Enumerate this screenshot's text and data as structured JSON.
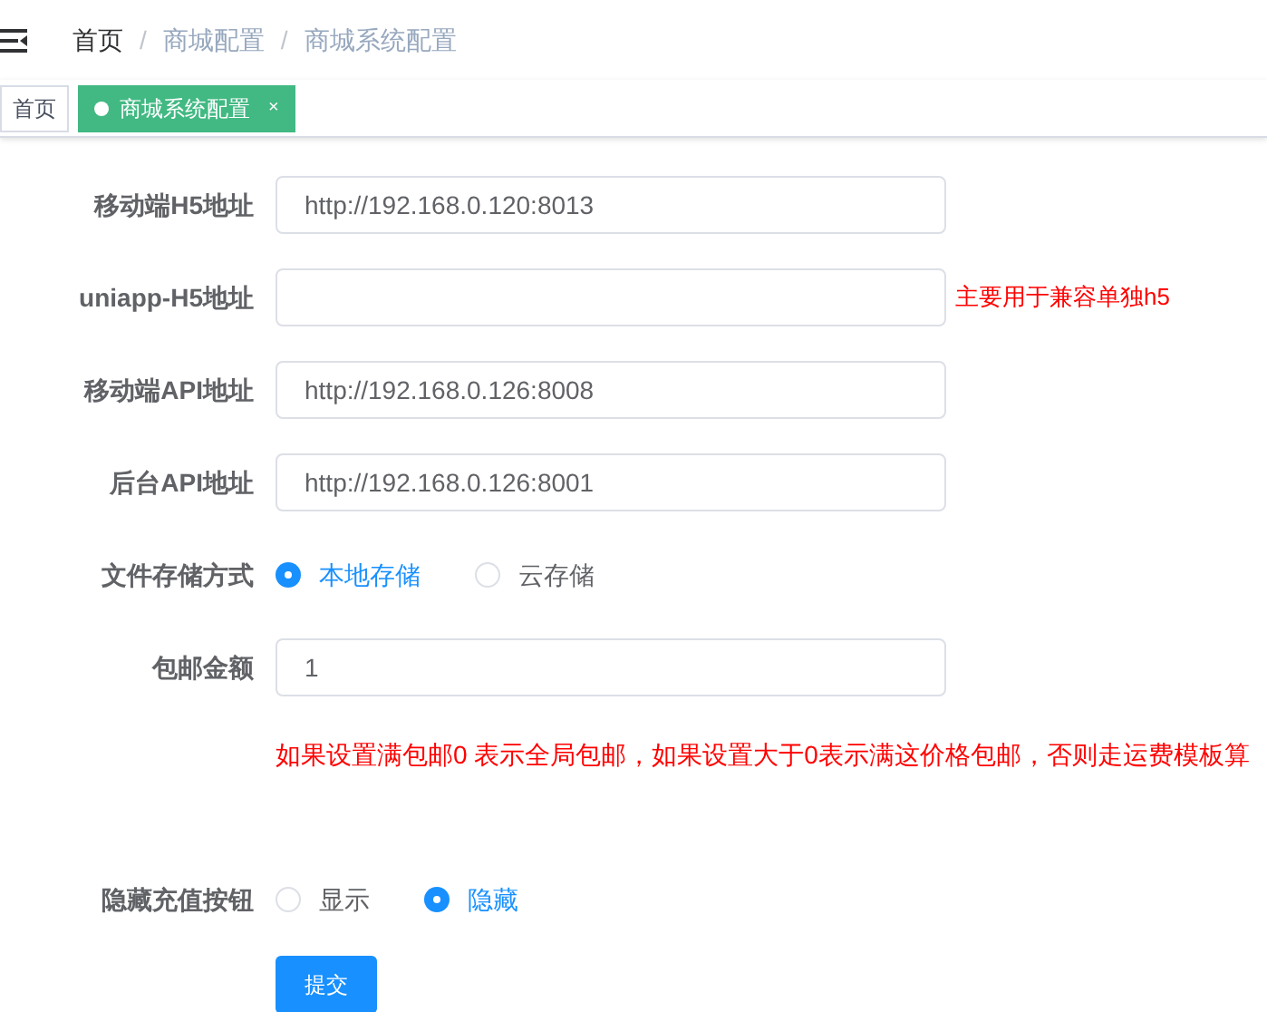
{
  "breadcrumb": [
    {
      "label": "首页",
      "current": true
    },
    {
      "separator": "/",
      "label": "商城配置",
      "current": false
    },
    {
      "separator": "/",
      "label": "商城系统配置",
      "current": false
    }
  ],
  "tabs": [
    {
      "label": "首页",
      "selected": false
    },
    {
      "label": "商城系统配置",
      "selected": true,
      "close": "×"
    }
  ],
  "form": {
    "fields": [
      {
        "kind": "input",
        "label": "移动端H5地址",
        "value": "http://192.168.0.120:8013"
      },
      {
        "kind": "input",
        "label": "uniapp-H5地址",
        "hint": "主要用于兼容单独h5"
      },
      {
        "kind": "input",
        "label": "移动端API地址",
        "value": "http://192.168.0.126:8008"
      },
      {
        "kind": "input",
        "label": "后台API地址",
        "value": "http://192.168.0.126:8001"
      },
      {
        "kind": "radio",
        "label": "文件存储方式",
        "options": [
          {
            "label": "本地存储",
            "selected": true
          },
          {
            "label": "云存储",
            "selected": false
          }
        ]
      },
      {
        "kind": "input",
        "label": "包邮金额",
        "value": "1"
      },
      {
        "kind": "note",
        "text": "如果设置满包邮0 表示全局包邮，如果设置大于0表示满这价格包邮，否则走运费模板算"
      },
      {
        "kind": "radio",
        "label": "隐藏充值按钮",
        "options": [
          {
            "label": "显示",
            "selected": false
          },
          {
            "label": "隐藏",
            "selected": true
          }
        ]
      }
    ],
    "submit": "提交"
  }
}
